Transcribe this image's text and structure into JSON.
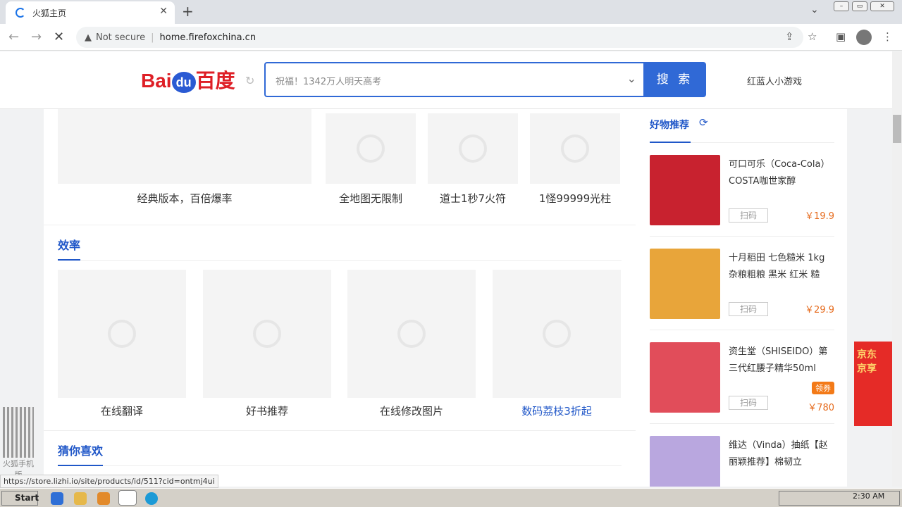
{
  "browser": {
    "tab_title": "火狐主页",
    "url_warning": "Not secure",
    "url": "home.firefoxchina.cn",
    "status_url": "https://store.lizhi.io/site/products/id/511?cid=ontmj4ui"
  },
  "header": {
    "logo_text": "Bai",
    "logo_du": "du",
    "logo_cn": "百度",
    "search_placeholder": "祝福！1342万人明天高考",
    "search_button": "搜 索",
    "game_link": "红蓝人小游戏"
  },
  "top_items": [
    {
      "label": "经典版本，百倍爆率"
    },
    {
      "label": "全地图无限制"
    },
    {
      "label": "道士1秒7火符"
    },
    {
      "label": "1怪99999光柱"
    }
  ],
  "section_efficiency": {
    "title": "效率",
    "items": [
      {
        "label": "在线翻译"
      },
      {
        "label": "好书推荐"
      },
      {
        "label": "在线修改图片"
      },
      {
        "label": "数码荔枝3折起"
      }
    ]
  },
  "section_guess": {
    "title": "猜你喜欢"
  },
  "aside": {
    "title": "好物推荐",
    "products": [
      {
        "name": "可口可乐（Coca-Cola）COSTA咖世家醇",
        "scan": "扫码",
        "price": "￥19.9",
        "coupon": "",
        "color": "#c8222f"
      },
      {
        "name": "十月稻田 七色糙米 1kg 杂粮粗粮 黑米 红米 糙",
        "scan": "扫码",
        "price": "￥29.9",
        "coupon": "",
        "color": "#e8a53a"
      },
      {
        "name": "资生堂（SHISEIDO）第三代红腰子精华50ml",
        "scan": "扫码",
        "price": "￥780",
        "coupon": "领券",
        "color": "#e14d5a"
      },
      {
        "name": "维达（Vinda）抽纸【赵丽颖推荐】棉韧立",
        "scan": "",
        "price": "",
        "coupon": "",
        "color": "#b9a7df"
      }
    ]
  },
  "jd_banner": "京东 京享",
  "qr": {
    "label": "火狐手机版"
  },
  "taskbar": {
    "start": "Start",
    "clock": "2:30 AM"
  }
}
